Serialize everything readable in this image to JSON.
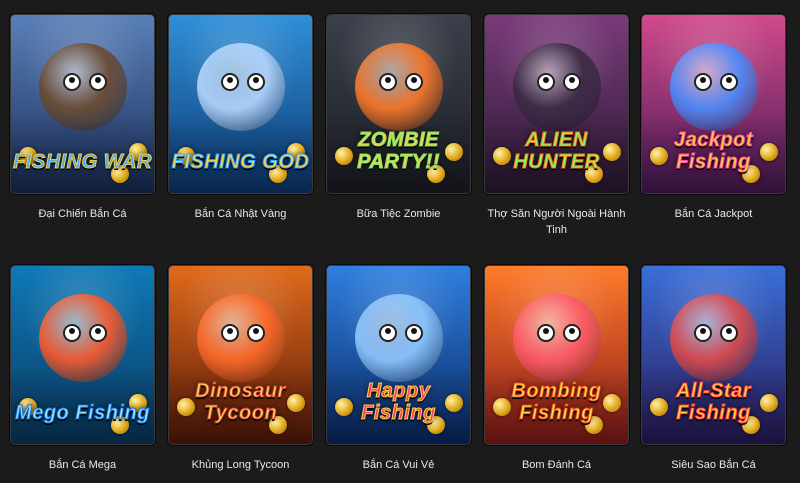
{
  "games": [
    {
      "title": "Đại Chiến Bắn Cá",
      "logo_text": "FISHING WAR",
      "icon": "pirate-ship-icon",
      "colors": {
        "bg_top": "#5a7fb8",
        "bg_bottom": "#1a2f5a",
        "logo": "#3fa7ff",
        "logo_alt": "#f5d24a",
        "mascot": "#6c4a2f"
      }
    },
    {
      "title": "Bắn Cá Nhật Vàng",
      "logo_text": "FISHING GOD",
      "icon": "dragon-icon",
      "colors": {
        "bg_top": "#2f8fd8",
        "bg_bottom": "#0e3b74",
        "logo": "#ffd24a",
        "logo_alt": "#2fa4ff",
        "mascot": "#b6d6ff"
      }
    },
    {
      "title": "Bữa Tiệc Zombie",
      "logo_text": "ZOMBIE PARTY!!",
      "icon": "zombie-icon",
      "colors": {
        "bg_top": "#3a3f4a",
        "bg_bottom": "#1b1e25",
        "logo": "#f2d34a",
        "logo_alt": "#7ee06a",
        "mascot": "#ff7a2a"
      }
    },
    {
      "title": "Thợ Săn Người Ngoài Hành Tinh",
      "logo_text": "ALIEN HUNTER",
      "icon": "alien-icon",
      "colors": {
        "bg_top": "#7a3a7a",
        "bg_bottom": "#2a1a33",
        "logo": "#7cff6a",
        "logo_alt": "#ff7a1a",
        "mascot": "#3a2a44"
      }
    },
    {
      "title": "Bắn Cá Jackpot",
      "logo_text": "Jackpot Fishing",
      "icon": "shark-icon",
      "colors": {
        "bg_top": "#d14a8a",
        "bg_bottom": "#4a1a58",
        "logo": "#ffcf3a",
        "logo_alt": "#ff4aa0",
        "mascot": "#4a8dff"
      }
    },
    {
      "title": "Bắn Cá Mega",
      "logo_text": "Mego Fishing",
      "icon": "octopus-icon",
      "colors": {
        "bg_top": "#0e79b7",
        "bg_bottom": "#0a3a62",
        "logo": "#9be7ff",
        "logo_alt": "#1a6fd0",
        "mascot": "#ff5a2a"
      }
    },
    {
      "title": "Khủng Long Tycoon",
      "logo_text": "Dinosaur Tycoon",
      "icon": "dinosaur-icon",
      "colors": {
        "bg_top": "#e06a1a",
        "bg_bottom": "#5a1a0a",
        "logo": "#ffd45a",
        "logo_alt": "#c0392b",
        "mascot": "#ff6a2a"
      }
    },
    {
      "title": "Bắn Cá Vui Vẻ",
      "logo_text": "Happy Fishing",
      "icon": "shark-icon",
      "colors": {
        "bg_top": "#2e7fe0",
        "bg_bottom": "#0a2a66",
        "logo": "#ff3a6a",
        "logo_alt": "#ffd24a",
        "mascot": "#8fc8ff"
      }
    },
    {
      "title": "Bom Đánh Cá",
      "logo_text": "Bombing Fishing",
      "icon": "fish-icon",
      "colors": {
        "bg_top": "#ff7a2a",
        "bg_bottom": "#8a1a1a",
        "logo": "#ffe14a",
        "logo_alt": "#e0401a",
        "mascot": "#ff5a6a"
      }
    },
    {
      "title": "Siêu Sao Bắn Cá",
      "logo_text": "All-Star Fishing",
      "icon": "monster-icon",
      "colors": {
        "bg_top": "#3a6fd8",
        "bg_bottom": "#2a1a5a",
        "logo": "#ffd24a",
        "logo_alt": "#ff3a3a",
        "mascot": "#e04a4a"
      }
    }
  ]
}
